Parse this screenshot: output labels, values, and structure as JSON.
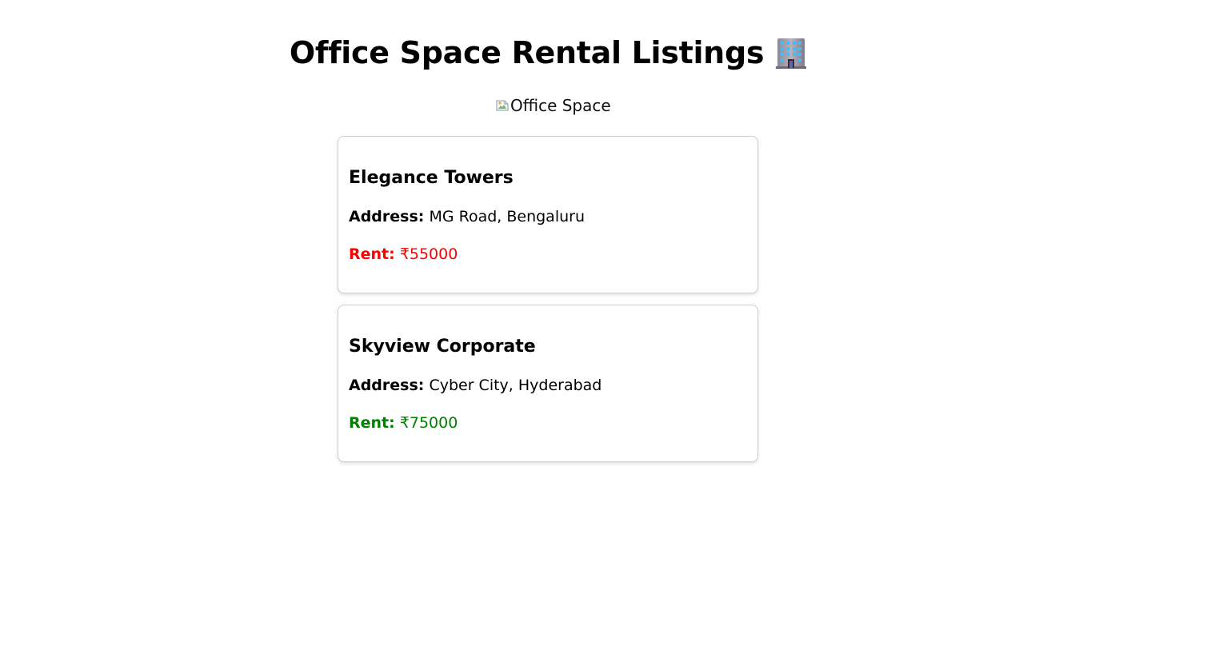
{
  "page": {
    "title": "Office Space Rental Listings",
    "title_icon": "office-building-icon"
  },
  "image": {
    "alt": "Office Space",
    "state": "broken-image-icon"
  },
  "listings": [
    {
      "name": "Elegance Towers",
      "address_label": "Address:",
      "address": "MG Road, Bengaluru",
      "rent_label": "Rent:",
      "rent": "₹55000",
      "rent_color": "#ff0000"
    },
    {
      "name": "Skyview Corporate",
      "address_label": "Address:",
      "address": "Cyber City, Hyderabad",
      "rent_label": "Rent:",
      "rent": "₹75000",
      "rent_color": "#008000"
    }
  ]
}
